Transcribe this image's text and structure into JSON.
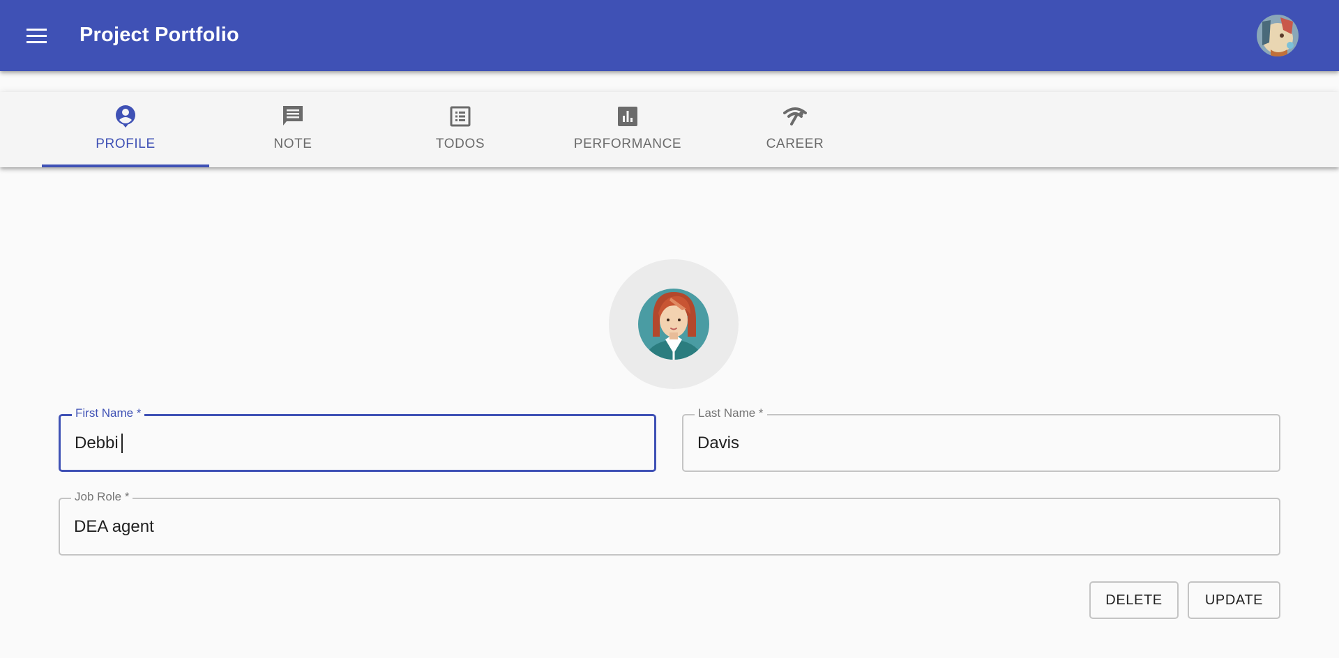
{
  "app": {
    "title": "Project Portfolio",
    "brand_color": "#3f51b5"
  },
  "tabs": [
    {
      "label": "PROFILE",
      "icon": "account-circle-icon",
      "active": true
    },
    {
      "label": "NOTE",
      "icon": "comment-icon",
      "active": false
    },
    {
      "label": "TODOS",
      "icon": "list-alt-icon",
      "active": false
    },
    {
      "label": "PERFORMANCE",
      "icon": "bar-chart-icon",
      "active": false
    },
    {
      "label": "CAREER",
      "icon": "signal-icon",
      "active": false
    }
  ],
  "form": {
    "first_name": {
      "label": "First Name *",
      "value": "Debbi"
    },
    "last_name": {
      "label": "Last Name *",
      "value": "Davis"
    },
    "job_role": {
      "label": "Job Role *",
      "value": "DEA agent"
    }
  },
  "actions": {
    "delete_label": "DELETE",
    "update_label": "UPDATE"
  }
}
